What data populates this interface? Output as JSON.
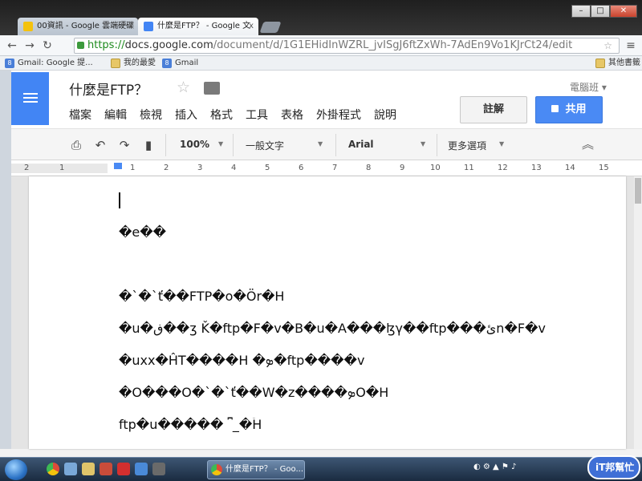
{
  "browser": {
    "tabs": [
      {
        "title": "00資訊 - Google 雲端硬碟",
        "active": false,
        "icon": "google-drive-icon"
      },
      {
        "title": "什麼是FTP？ - Google 文",
        "active": true,
        "icon": "google-docs-icon"
      }
    ],
    "close_glyph": "x",
    "url_scheme": "https://",
    "url_host": "docs.google.com",
    "url_path": "/document/d/1G1EHidInWZRL_jvISgJ6ftZxWh-7AdEn9Vo1KJrCt24/edit",
    "bookmarks": [
      {
        "label": "Gmail: Google 提...",
        "icon": "gmail-icon"
      },
      {
        "label": "我的最愛",
        "icon": "folder-icon"
      },
      {
        "label": "Gmail",
        "icon": "gmail-icon"
      }
    ],
    "other_bookmarks": "其他書籤"
  },
  "docs": {
    "title": "什麼是FTP？",
    "user": "電腦班 ▾",
    "menu": [
      "檔案",
      "編輯",
      "檢視",
      "插入",
      "格式",
      "工具",
      "表格",
      "外掛程式",
      "說明"
    ],
    "comment_label": "註解",
    "share_label": "共用",
    "zoom": "100%",
    "style": "一般文字",
    "font": "Arial",
    "more": "更多選項",
    "ruler_numbers": [
      "2",
      "1",
      "1",
      "2",
      "3",
      "4",
      "5",
      "6",
      "7",
      "8",
      "9",
      "10",
      "11",
      "12",
      "13",
      "14",
      "15"
    ]
  },
  "document": {
    "paragraphs": [
      "�e��",
      "�`�`ť��FTP�o�Ör�H",
      "�u�ڧ��ʒ  Ǩ�ftp�F�v�B�u�A���ɮγ��ftp���ئn�F�v",
      "�uxx�ĤT����H �ܤ�ftp����v",
      "�O���O�`�`ť��W�z����ܤO�H",
      "ftp�u�����  ⎴_�ۤH"
    ]
  },
  "taskbar": {
    "active_task": "什麼是FTP？ - Goo...",
    "badge": "iT邦幫忙"
  }
}
